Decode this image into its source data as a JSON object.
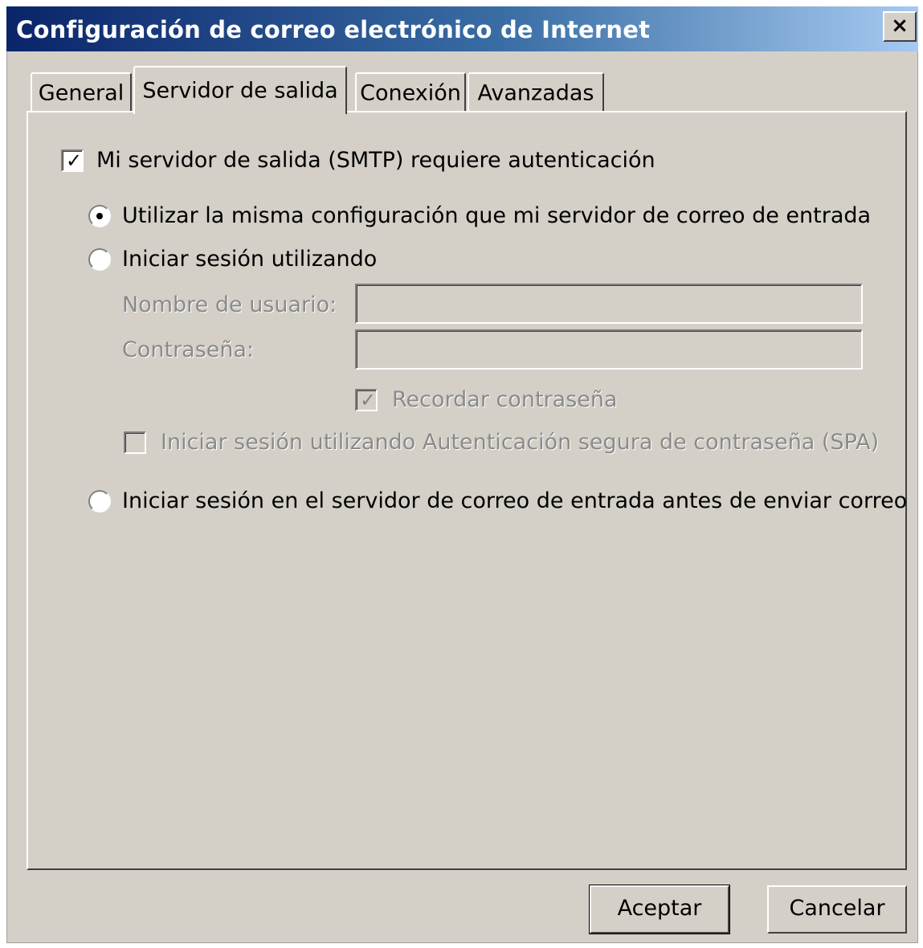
{
  "window": {
    "title": "Configuración de correo electrónico de Internet",
    "close_label": "×"
  },
  "tabs": [
    {
      "label": "General",
      "active": false
    },
    {
      "label": "Servidor de salida",
      "active": true
    },
    {
      "label": "Conexión",
      "active": false
    },
    {
      "label": "Avanzadas",
      "active": false
    }
  ],
  "outgoing": {
    "smtp_auth_label": "Mi servidor de salida (SMTP) requiere autenticación",
    "smtp_auth_checked": true,
    "options": [
      {
        "label": "Utilizar la misma configuración que mi servidor de correo de entrada",
        "selected": true
      },
      {
        "label": "Iniciar sesión utilizando",
        "selected": false
      },
      {
        "label": "Iniciar sesión en el servidor de correo de entrada antes de enviar correo",
        "selected": false
      }
    ],
    "username_label": "Nombre de usuario:",
    "username_value": "",
    "password_label": "Contraseña:",
    "password_value": "",
    "remember_password_label": "Recordar contraseña",
    "remember_password_checked": true,
    "spa_label": "Iniciar sesión utilizando Autenticación segura de contraseña (SPA)",
    "spa_checked": false
  },
  "buttons": {
    "ok": "Aceptar",
    "cancel": "Cancelar"
  }
}
